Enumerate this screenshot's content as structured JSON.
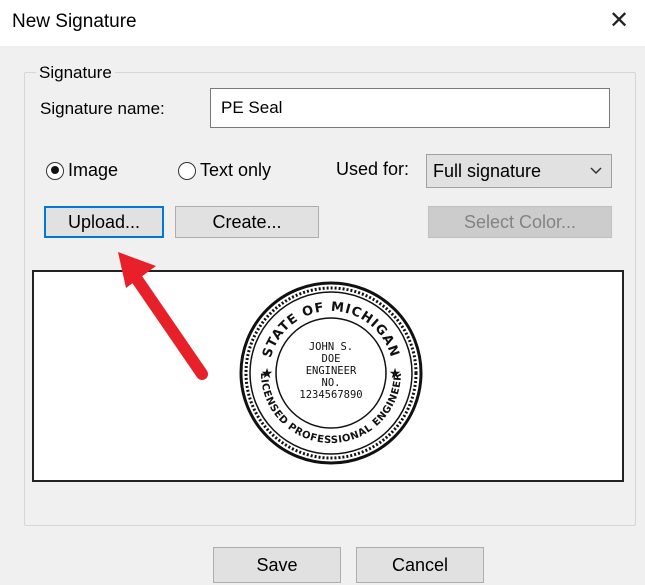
{
  "window": {
    "title": "New Signature",
    "close_glyph": "✕"
  },
  "group": {
    "label": "Signature"
  },
  "name_field": {
    "label": "Signature name:",
    "value": "PE Seal"
  },
  "mode": {
    "options": [
      {
        "label": "Image",
        "checked": true
      },
      {
        "label": "Text only",
        "checked": false
      }
    ]
  },
  "used_for": {
    "label": "Used for:",
    "selected": "Full signature",
    "icon": "chevron-down-icon"
  },
  "buttons": {
    "upload": "Upload...",
    "create": "Create...",
    "select_color": "Select Color...",
    "save": "Save",
    "cancel": "Cancel"
  },
  "seal": {
    "top_text": "STATE OF MICHIGAN",
    "bottom_text": "LICENSED PROFESSIONAL ENGINEER",
    "lines": [
      "JOHN S.",
      "DOE",
      "ENGINEER",
      "NO.",
      "1234567890"
    ]
  },
  "colors": {
    "accent": "#0078d7",
    "arrow": "#e8202a"
  }
}
